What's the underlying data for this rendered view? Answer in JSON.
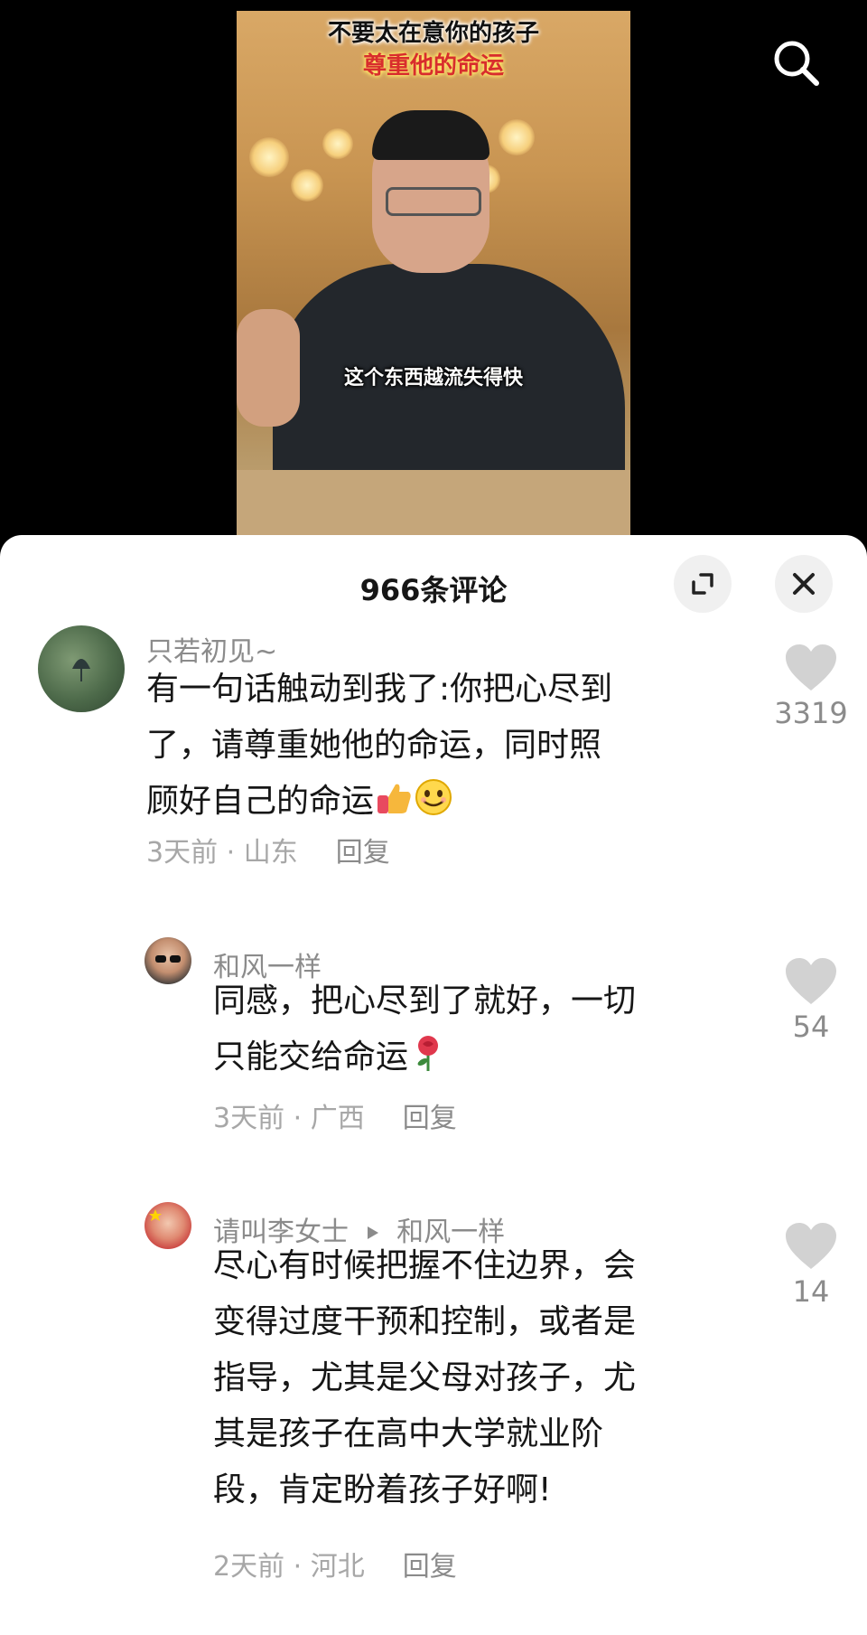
{
  "video": {
    "caption_line1": "不要太在意你的孩子",
    "caption_line2": "尊重他的命运",
    "subtitle": "这个东西越流失得快",
    "search_icon": "search-icon"
  },
  "panel": {
    "title": "966条评论",
    "expand_icon": "collapse-expand-icon",
    "close_icon": "close-icon"
  },
  "comments": [
    {
      "username": "只若初见~",
      "text_line1": "有一句话触动到我了:你把心尽到",
      "text_line2": "了，请尊重她他的命运，同时照",
      "text_line3": "顾好自己的命运",
      "emojis": [
        "thumbs-up-emoji",
        "smile-emoji"
      ],
      "time_location": "3天前 · 山东",
      "reply": "回复",
      "likes": "3319"
    },
    {
      "username": "和风一样",
      "text_line1": "同感，把心尽到了就好，一切",
      "text_line2": "只能交给命运",
      "emojis": [
        "rose-emoji"
      ],
      "time_location": "3天前 · 广西",
      "reply": "回复",
      "likes": "54"
    },
    {
      "username": "请叫李女士",
      "reply_to": "和风一样",
      "text_line1": "尽心有时候把握不住边界，会",
      "text_line2": "变得过度干预和控制，或者是",
      "text_line3": "指导，尤其是父母对孩子，尤",
      "text_line4": "其是孩子在高中大学就业阶",
      "text_line5": "段，肯定盼着孩子好啊!",
      "time_location": "2天前 · 河北",
      "reply": "回复",
      "likes": "14"
    }
  ]
}
